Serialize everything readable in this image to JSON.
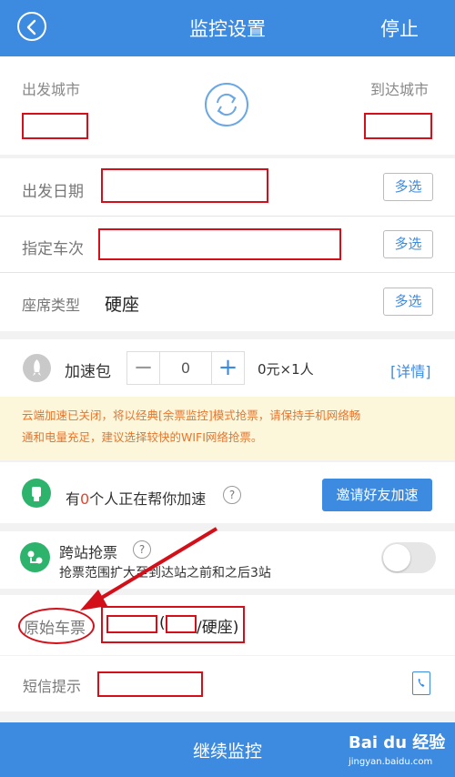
{
  "header": {
    "title": "监控设置",
    "stop_label": "停止"
  },
  "route": {
    "from_label": "出发城市",
    "to_label": "到达城市"
  },
  "fields": {
    "date_label": "出发日期",
    "train_label": "指定车次",
    "seat_label": "座席类型",
    "seat_value": "硬座",
    "multi_label": "多选"
  },
  "speed": {
    "label": "加速包",
    "minus": "−",
    "count": "0",
    "plus": "+",
    "price": "0元×1人",
    "details_link": "[详情]"
  },
  "notice": {
    "line1": "云端加速已关闭，将以经典[余票监控]模式抢票，请保持手机网络畅",
    "line2": "通和电量充足，建议选择较快的WIFI网络抢票。"
  },
  "helpers": {
    "prefix": "有",
    "count": "0",
    "suffix": "个人正在帮你加速",
    "help": "?",
    "invite_label": "邀请好友加速"
  },
  "cross_station": {
    "title": "跨站抢票",
    "help": "?",
    "description": "抢票范围扩大至到达站之前和之后3站",
    "enabled": false
  },
  "original_ticket": {
    "label": "原始车票",
    "open_paren": "(",
    "seat_text": "/硬座)"
  },
  "sms": {
    "label": "短信提示"
  },
  "footer": {
    "continue_label": "继续监控"
  },
  "watermark": {
    "brand": "Bai du 经验",
    "url": "jingyan.baidu.com"
  },
  "colors": {
    "primary": "#3d8be0",
    "notice_bg": "#fcf6db",
    "notice_text": "#e7752c",
    "annotation": "#d3101a",
    "green": "#2db36b"
  }
}
